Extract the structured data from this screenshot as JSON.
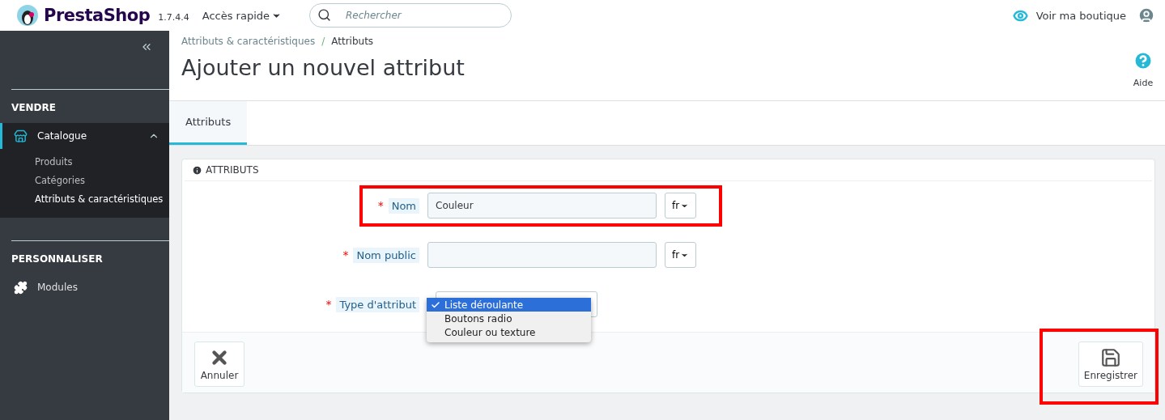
{
  "header": {
    "brand": "PrestaShop",
    "version": "1.7.4.4",
    "quick_access": "Accès rapide",
    "search": {
      "placeholder": "Rechercher"
    },
    "view_shop": "Voir ma boutique"
  },
  "sidebar": {
    "sections": [
      {
        "title": "VENDRE",
        "items": [
          {
            "label": "Catalogue",
            "selected": true,
            "expanded": true,
            "children": [
              {
                "label": "Produits",
                "selected": false
              },
              {
                "label": "Catégories",
                "selected": false
              },
              {
                "label": "Attributs & caractéristiques",
                "selected": true
              }
            ]
          }
        ]
      },
      {
        "title": "PERSONNALISER",
        "items": [
          {
            "label": "Modules",
            "selected": false,
            "expanded": false
          }
        ]
      }
    ]
  },
  "breadcrumb": {
    "items": [
      "Attributs & caractéristiques",
      "Attributs"
    ],
    "separator": "/"
  },
  "title": "Ajouter un nouvel attribut",
  "help": "Aide",
  "tabs": [
    {
      "label": "Attributs",
      "selected": true
    }
  ],
  "panel": {
    "heading": "ATTRIBUTS",
    "fields": [
      {
        "kind": "text",
        "required_mark": "*",
        "label": "Nom",
        "value": "Couleur",
        "language": "fr",
        "highlighted": true
      },
      {
        "kind": "text",
        "required_mark": "*",
        "label": "Nom public",
        "language": "fr",
        "highlighted": false
      },
      {
        "kind": "select",
        "required_mark": "*",
        "label": "Type d'attribut",
        "highlighted": false,
        "options": [
          {
            "label": "Liste déroulante",
            "selected": true
          },
          {
            "label": "Boutons radio",
            "selected": false
          },
          {
            "label": "Couleur ou texture",
            "selected": false
          }
        ]
      }
    ],
    "cancel": "Annuler",
    "save": {
      "label": "Enregistrer",
      "highlighted": true
    }
  }
}
